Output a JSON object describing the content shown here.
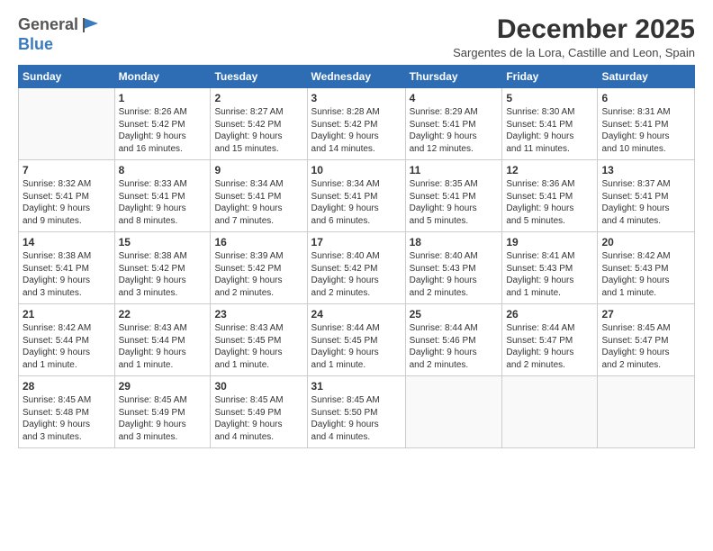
{
  "header": {
    "logo_general": "General",
    "logo_blue": "Blue",
    "month_title": "December 2025",
    "subtitle": "Sargentes de la Lora, Castille and Leon, Spain"
  },
  "weekdays": [
    "Sunday",
    "Monday",
    "Tuesday",
    "Wednesday",
    "Thursday",
    "Friday",
    "Saturday"
  ],
  "weeks": [
    [
      {
        "day": "",
        "text": ""
      },
      {
        "day": "1",
        "text": "Sunrise: 8:26 AM\nSunset: 5:42 PM\nDaylight: 9 hours\nand 16 minutes."
      },
      {
        "day": "2",
        "text": "Sunrise: 8:27 AM\nSunset: 5:42 PM\nDaylight: 9 hours\nand 15 minutes."
      },
      {
        "day": "3",
        "text": "Sunrise: 8:28 AM\nSunset: 5:42 PM\nDaylight: 9 hours\nand 14 minutes."
      },
      {
        "day": "4",
        "text": "Sunrise: 8:29 AM\nSunset: 5:41 PM\nDaylight: 9 hours\nand 12 minutes."
      },
      {
        "day": "5",
        "text": "Sunrise: 8:30 AM\nSunset: 5:41 PM\nDaylight: 9 hours\nand 11 minutes."
      },
      {
        "day": "6",
        "text": "Sunrise: 8:31 AM\nSunset: 5:41 PM\nDaylight: 9 hours\nand 10 minutes."
      }
    ],
    [
      {
        "day": "7",
        "text": "Sunrise: 8:32 AM\nSunset: 5:41 PM\nDaylight: 9 hours\nand 9 minutes."
      },
      {
        "day": "8",
        "text": "Sunrise: 8:33 AM\nSunset: 5:41 PM\nDaylight: 9 hours\nand 8 minutes."
      },
      {
        "day": "9",
        "text": "Sunrise: 8:34 AM\nSunset: 5:41 PM\nDaylight: 9 hours\nand 7 minutes."
      },
      {
        "day": "10",
        "text": "Sunrise: 8:34 AM\nSunset: 5:41 PM\nDaylight: 9 hours\nand 6 minutes."
      },
      {
        "day": "11",
        "text": "Sunrise: 8:35 AM\nSunset: 5:41 PM\nDaylight: 9 hours\nand 5 minutes."
      },
      {
        "day": "12",
        "text": "Sunrise: 8:36 AM\nSunset: 5:41 PM\nDaylight: 9 hours\nand 5 minutes."
      },
      {
        "day": "13",
        "text": "Sunrise: 8:37 AM\nSunset: 5:41 PM\nDaylight: 9 hours\nand 4 minutes."
      }
    ],
    [
      {
        "day": "14",
        "text": "Sunrise: 8:38 AM\nSunset: 5:41 PM\nDaylight: 9 hours\nand 3 minutes."
      },
      {
        "day": "15",
        "text": "Sunrise: 8:38 AM\nSunset: 5:42 PM\nDaylight: 9 hours\nand 3 minutes."
      },
      {
        "day": "16",
        "text": "Sunrise: 8:39 AM\nSunset: 5:42 PM\nDaylight: 9 hours\nand 2 minutes."
      },
      {
        "day": "17",
        "text": "Sunrise: 8:40 AM\nSunset: 5:42 PM\nDaylight: 9 hours\nand 2 minutes."
      },
      {
        "day": "18",
        "text": "Sunrise: 8:40 AM\nSunset: 5:43 PM\nDaylight: 9 hours\nand 2 minutes."
      },
      {
        "day": "19",
        "text": "Sunrise: 8:41 AM\nSunset: 5:43 PM\nDaylight: 9 hours\nand 1 minute."
      },
      {
        "day": "20",
        "text": "Sunrise: 8:42 AM\nSunset: 5:43 PM\nDaylight: 9 hours\nand 1 minute."
      }
    ],
    [
      {
        "day": "21",
        "text": "Sunrise: 8:42 AM\nSunset: 5:44 PM\nDaylight: 9 hours\nand 1 minute."
      },
      {
        "day": "22",
        "text": "Sunrise: 8:43 AM\nSunset: 5:44 PM\nDaylight: 9 hours\nand 1 minute."
      },
      {
        "day": "23",
        "text": "Sunrise: 8:43 AM\nSunset: 5:45 PM\nDaylight: 9 hours\nand 1 minute."
      },
      {
        "day": "24",
        "text": "Sunrise: 8:44 AM\nSunset: 5:45 PM\nDaylight: 9 hours\nand 1 minute."
      },
      {
        "day": "25",
        "text": "Sunrise: 8:44 AM\nSunset: 5:46 PM\nDaylight: 9 hours\nand 2 minutes."
      },
      {
        "day": "26",
        "text": "Sunrise: 8:44 AM\nSunset: 5:47 PM\nDaylight: 9 hours\nand 2 minutes."
      },
      {
        "day": "27",
        "text": "Sunrise: 8:45 AM\nSunset: 5:47 PM\nDaylight: 9 hours\nand 2 minutes."
      }
    ],
    [
      {
        "day": "28",
        "text": "Sunrise: 8:45 AM\nSunset: 5:48 PM\nDaylight: 9 hours\nand 3 minutes."
      },
      {
        "day": "29",
        "text": "Sunrise: 8:45 AM\nSunset: 5:49 PM\nDaylight: 9 hours\nand 3 minutes."
      },
      {
        "day": "30",
        "text": "Sunrise: 8:45 AM\nSunset: 5:49 PM\nDaylight: 9 hours\nand 4 minutes."
      },
      {
        "day": "31",
        "text": "Sunrise: 8:45 AM\nSunset: 5:50 PM\nDaylight: 9 hours\nand 4 minutes."
      },
      {
        "day": "",
        "text": ""
      },
      {
        "day": "",
        "text": ""
      },
      {
        "day": "",
        "text": ""
      }
    ]
  ]
}
